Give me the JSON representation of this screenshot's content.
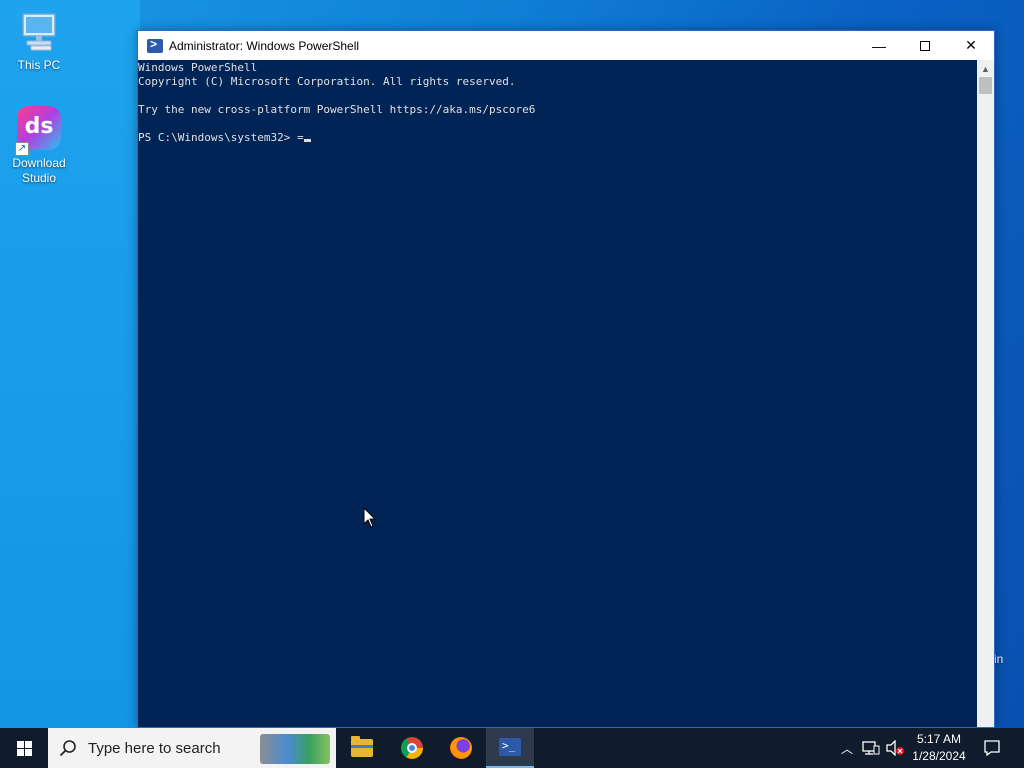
{
  "desktop": {
    "icons": [
      {
        "label": "This PC"
      },
      {
        "label": "Download Studio",
        "logo_text": "ds"
      }
    ],
    "side_fragment": "in"
  },
  "window": {
    "title": "Administrator: Windows PowerShell",
    "controls": {
      "minimize": "—",
      "close": "✕"
    },
    "console_lines": [
      "Windows PowerShell",
      "Copyright (C) Microsoft Corporation. All rights reserved.",
      "",
      "Try the new cross-platform PowerShell https://aka.ms/pscore6",
      ""
    ],
    "prompt": "PS C:\\Windows\\system32> ",
    "typed": "=",
    "background": "#012456",
    "text_color": "#e0e0e0"
  },
  "taskbar": {
    "search_placeholder": "Type here to search",
    "apps": [
      {
        "name": "File Explorer",
        "icon": "folder-icon"
      },
      {
        "name": "Google Chrome",
        "icon": "chrome-icon"
      },
      {
        "name": "Firefox",
        "icon": "firefox-icon"
      },
      {
        "name": "Windows PowerShell",
        "icon": "powershell-icon",
        "active": true
      }
    ],
    "clock": {
      "time": "5:17 AM",
      "date": "1/28/2024"
    }
  }
}
